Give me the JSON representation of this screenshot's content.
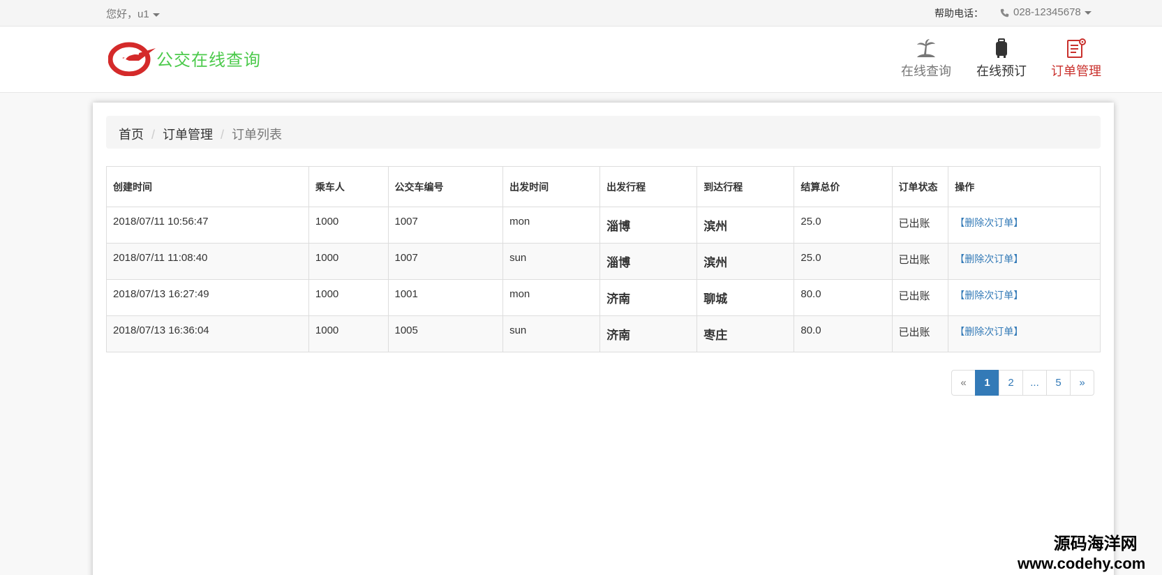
{
  "topbar": {
    "greeting": "您好，u1",
    "help_label": "帮助电话：",
    "phone": "028-12345678"
  },
  "header": {
    "logo_text": "公交在线查询",
    "nav": [
      {
        "label": "在线查询",
        "icon": "palm-island-icon"
      },
      {
        "label": "在线预订",
        "icon": "luggage-icon"
      },
      {
        "label": "订单管理",
        "icon": "order-settings-icon"
      }
    ]
  },
  "breadcrumb": {
    "home": "首页",
    "section": "订单管理",
    "current": "订单列表"
  },
  "table": {
    "headers": [
      "创建时间",
      "乘车人",
      "公交车编号",
      "出发时间",
      "出发行程",
      "到达行程",
      "结算总价",
      "订单状态",
      "操作"
    ],
    "rows": [
      {
        "created": "2018/07/11 10:56:47",
        "passenger": "1000",
        "bus_no": "1007",
        "depart_time": "mon",
        "from": "淄博",
        "to": "滨州",
        "total": "25.0",
        "status": "已出账",
        "action": "【删除次订单】"
      },
      {
        "created": "2018/07/11 11:08:40",
        "passenger": "1000",
        "bus_no": "1007",
        "depart_time": "sun",
        "from": "淄博",
        "to": "滨州",
        "total": "25.0",
        "status": "已出账",
        "action": "【删除次订单】"
      },
      {
        "created": "2018/07/13 16:27:49",
        "passenger": "1000",
        "bus_no": "1001",
        "depart_time": "mon",
        "from": "济南",
        "to": "聊城",
        "total": "80.0",
        "status": "已出账",
        "action": "【删除次订单】"
      },
      {
        "created": "2018/07/13 16:36:04",
        "passenger": "1000",
        "bus_no": "1005",
        "depart_time": "sun",
        "from": "济南",
        "to": "枣庄",
        "total": "80.0",
        "status": "已出账",
        "action": "【删除次订单】"
      }
    ]
  },
  "pagination": {
    "prev": "«",
    "pages": [
      "1",
      "2",
      "...",
      "5"
    ],
    "current": "1",
    "next": "»"
  },
  "watermark": {
    "line1": "源码海洋网",
    "line2": "www.codehy.com"
  },
  "colors": {
    "accent": "#c9302c",
    "link": "#337ab7",
    "logo_text": "#4cca4c"
  }
}
